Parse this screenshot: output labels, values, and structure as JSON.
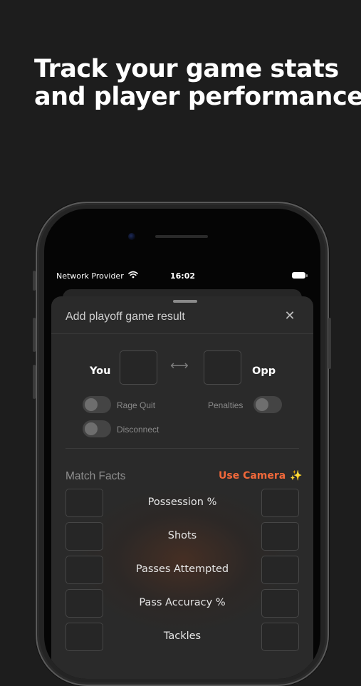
{
  "headline": {
    "line1": "Track your game stats",
    "line2": "and player performance"
  },
  "status_bar": {
    "carrier": "Network Provider",
    "time": "16:02",
    "wifi_icon": "wifi-icon",
    "battery_icon": "battery-icon"
  },
  "sheet": {
    "title": "Add playoff game result",
    "close_icon": "✕"
  },
  "score": {
    "you_label": "You",
    "opp_label": "Opp",
    "you_value": "",
    "opp_value": "",
    "swap_icon": "⟷"
  },
  "toggles": {
    "rage_quit": {
      "label": "Rage Quit",
      "on": false
    },
    "penalties": {
      "label": "Penalties",
      "on": false
    },
    "disconnect": {
      "label": "Disconnect",
      "on": false
    }
  },
  "match_facts": {
    "title": "Match Facts",
    "camera_button": "Use Camera",
    "camera_icon": "✨",
    "stats": [
      {
        "label": "Possession %"
      },
      {
        "label": "Shots"
      },
      {
        "label": "Passes Attempted"
      },
      {
        "label": "Pass Accuracy %"
      },
      {
        "label": "Tackles"
      }
    ]
  },
  "colors": {
    "background": "#1d1d1d",
    "sheet": "#2a2a2a",
    "accent": "#f0683a",
    "muted_text": "#8a8a8a"
  }
}
